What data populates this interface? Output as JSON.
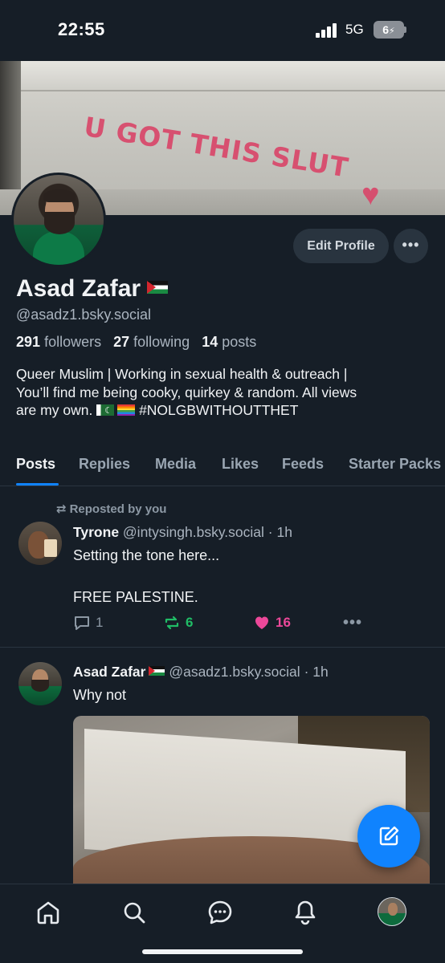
{
  "status_bar": {
    "time": "22:55",
    "network": "5G",
    "battery": "6"
  },
  "banner": {
    "graffiti_text": "U GOT THIS SLUT",
    "heart": "♥"
  },
  "profile": {
    "display_name": "Asad Zafar",
    "handle": "@asadz1.bsky.social",
    "followers_count": "291",
    "followers_label": "followers",
    "following_count": "27",
    "following_label": "following",
    "posts_count": "14",
    "posts_label": "posts",
    "bio_line1": "Queer Muslim | Working in sexual health & outreach |",
    "bio_line2": "You’ll find me being cooky, quirkey & random. All views",
    "bio_line3_pre": "are my own.",
    "bio_line3_post": "#NOLGBWITHOUTTHET",
    "edit_label": "Edit Profile",
    "more_label": "•••"
  },
  "tabs": [
    {
      "label": "Posts",
      "active": true
    },
    {
      "label": "Replies",
      "active": false
    },
    {
      "label": "Media",
      "active": false
    },
    {
      "label": "Likes",
      "active": false
    },
    {
      "label": "Feeds",
      "active": false
    },
    {
      "label": "Starter Packs",
      "active": false
    }
  ],
  "posts": [
    {
      "repost_label": "Reposted by you",
      "author": "Tyrone",
      "handle": "@intysingh.bsky.social",
      "time": "· 1h",
      "text_line1": "Setting the tone here...",
      "text_line2": "FREE PALESTINE.",
      "replies": "1",
      "reposts": "6",
      "likes": "16",
      "more": "•••"
    },
    {
      "author": "Asad Zafar",
      "handle": "@asadz1.bsky.social",
      "time": "· 1h",
      "text_line1": "Why not"
    }
  ],
  "colors": {
    "background": "#161e27",
    "accent": "#1083fe",
    "repost_green": "#20bc66",
    "like_pink": "#ec4899"
  },
  "icons": {
    "nav": [
      "home-icon",
      "search-icon",
      "chat-icon",
      "bell-icon",
      "profile-avatar"
    ],
    "fab": "compose-icon"
  }
}
